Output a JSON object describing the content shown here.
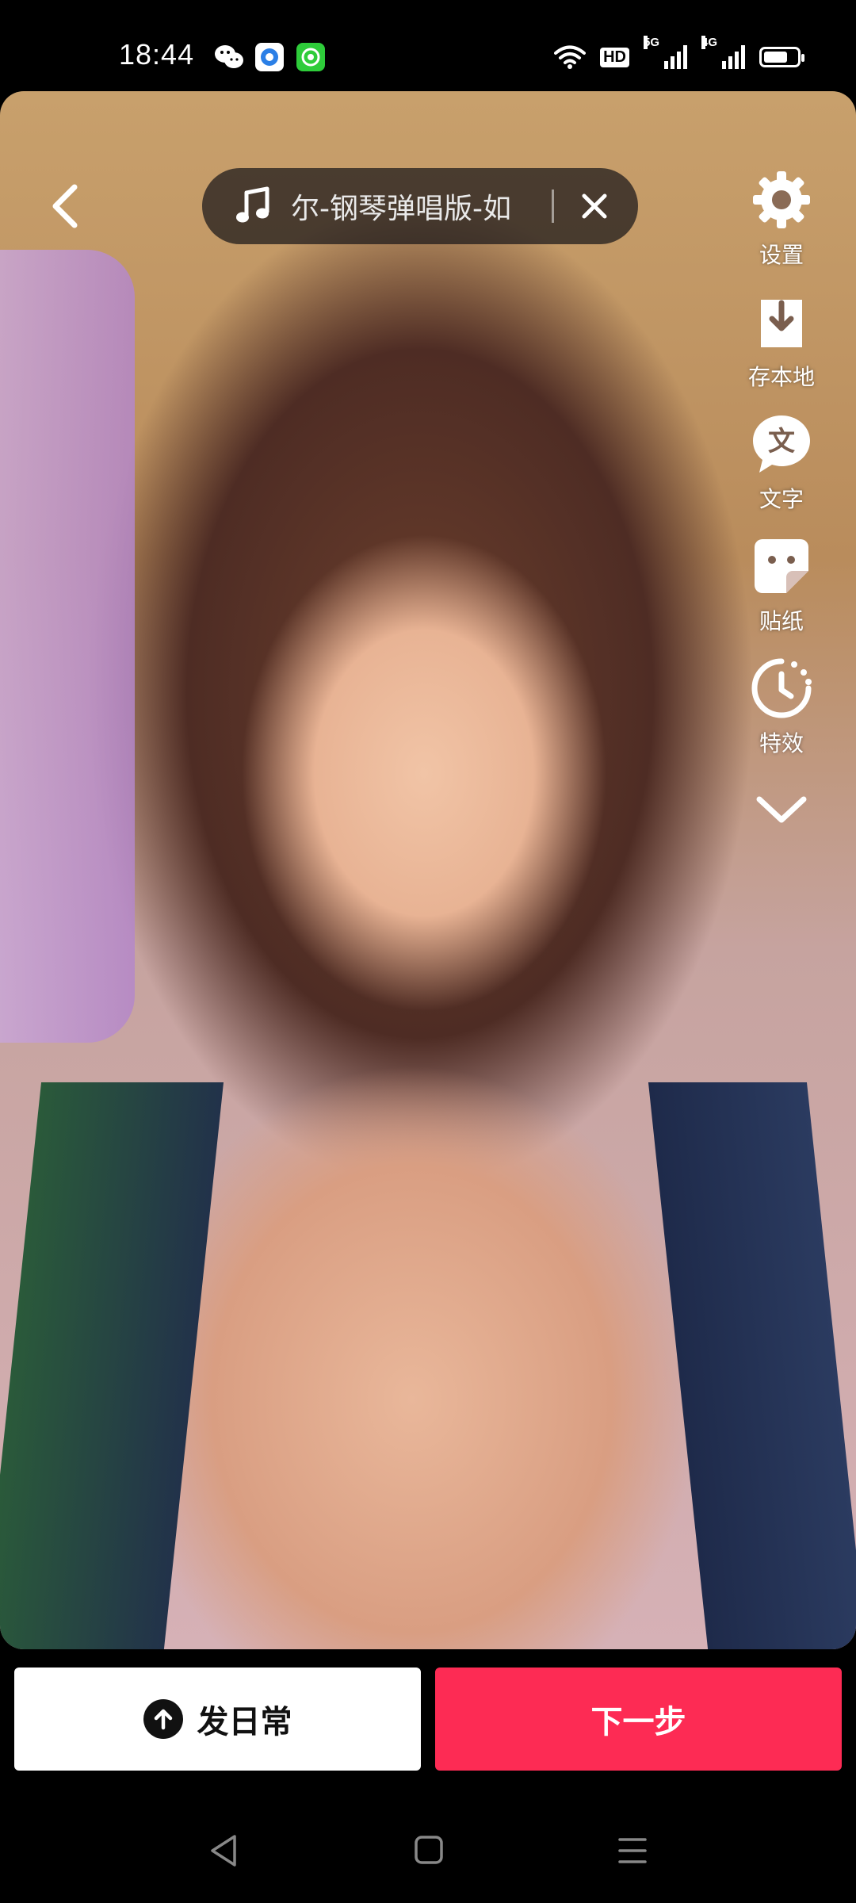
{
  "status_bar": {
    "time": "18:44",
    "network_badge": "HD",
    "signal_1_label": "5G",
    "signal_2_label": "4G",
    "battery_level": 0.75
  },
  "music": {
    "title": "尔-钢琴弹唱版-如"
  },
  "side_menu": {
    "settings": "设置",
    "save_local": "存本地",
    "text": "文字",
    "sticker": "贴纸",
    "effects": "特效"
  },
  "actions": {
    "post_daily": "发日常",
    "next_step": "下一步"
  },
  "colors": {
    "accent": "#fd2b54",
    "pill_bg": "rgba(25,22,25,0.72)"
  }
}
